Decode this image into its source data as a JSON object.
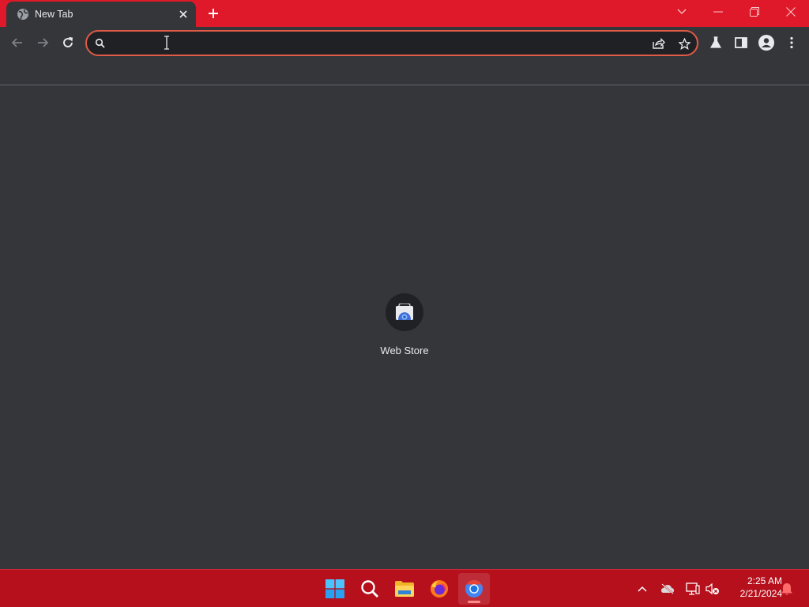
{
  "tab": {
    "title": "New Tab",
    "favicon": "globe-icon",
    "close_icon": "close-icon"
  },
  "tabstrip": {
    "new_tab_icon": "plus-icon",
    "tab_search_icon": "chevron-down-icon",
    "minimize_icon": "minimize-icon",
    "restore_icon": "restore-icon",
    "close_window_icon": "close-icon",
    "accent_color": "#e0192a"
  },
  "toolbar": {
    "back_icon": "arrow-left-icon",
    "forward_icon": "arrow-right-icon",
    "reload_icon": "reload-icon",
    "omnibox": {
      "value": "",
      "placeholder": "",
      "search_icon": "search-icon",
      "share_icon": "share-icon",
      "bookmark_icon": "star-icon",
      "border_color": "#e05a48"
    },
    "labs_icon": "flask-icon",
    "side_panel_icon": "side-panel-icon",
    "profile_icon": "profile-icon",
    "menu_icon": "kebab-menu-icon"
  },
  "content": {
    "shortcuts": [
      {
        "label": "Web Store",
        "icon": "web-store-icon"
      }
    ]
  },
  "taskbar": {
    "apps": [
      {
        "name": "Start",
        "icon": "windows-start-icon"
      },
      {
        "name": "Search",
        "icon": "search-icon"
      },
      {
        "name": "File Explorer",
        "icon": "folder-icon"
      },
      {
        "name": "Firefox",
        "icon": "firefox-icon"
      },
      {
        "name": "Chrome",
        "icon": "chrome-icon",
        "active": true
      }
    ],
    "tray": {
      "overflow_icon": "chevron-up-icon",
      "onedrive_icon": "cloud-off-icon",
      "network_icon": "network-icon",
      "volume_icon": "volume-muted-icon",
      "notification_icon": "bell-icon"
    },
    "clock": {
      "time": "2:25 AM",
      "date": "2/21/2024"
    },
    "color": "#b5101c"
  }
}
